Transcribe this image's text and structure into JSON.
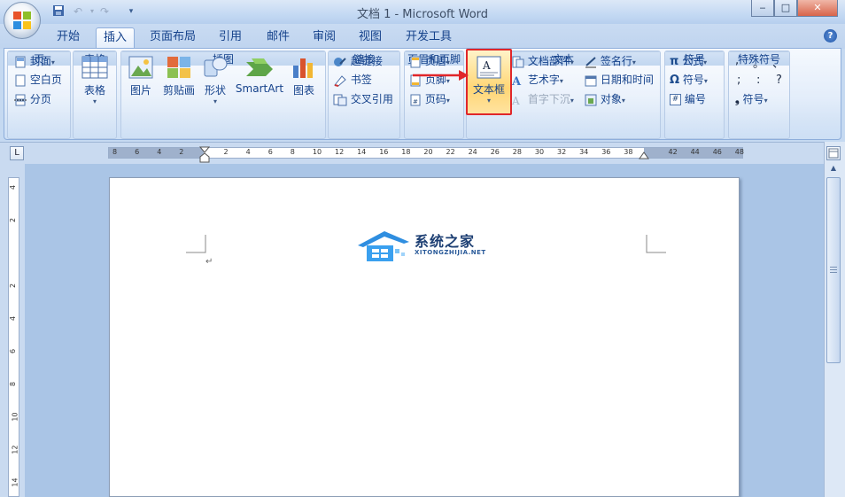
{
  "window": {
    "title": "文档 1 - Microsoft Word"
  },
  "quick_access": {
    "save": "save-icon",
    "undo": "↶",
    "redo": "↷",
    "more": "▾"
  },
  "window_buttons": {
    "minimize": "‒",
    "maximize": "□",
    "close": "✕"
  },
  "tabs": [
    "开始",
    "插入",
    "页面布局",
    "引用",
    "邮件",
    "审阅",
    "视图",
    "开发工具"
  ],
  "active_tab": "插入",
  "help": "?",
  "ribbon": {
    "pages": {
      "label": "页",
      "cover": "封面",
      "blank": "空白页",
      "break": "分页"
    },
    "tables": {
      "label": "表格",
      "table": "表格"
    },
    "illustrations": {
      "label": "插图",
      "picture": "图片",
      "clipart": "剪贴画",
      "shapes": "形状",
      "smartart": "SmartArt",
      "chart": "图表"
    },
    "links": {
      "label": "链接",
      "hyperlink": "超链接",
      "bookmark": "书签",
      "crossref": "交叉引用"
    },
    "header_footer": {
      "label": "页眉和页脚",
      "header": "页眉",
      "footer": "页脚",
      "pagenum": "页码"
    },
    "text": {
      "label": "文本",
      "textbox": "文本框",
      "quickparts": "文档部件",
      "wordart": "艺术字",
      "dropcap": "首字下沉",
      "signature": "签名行",
      "datetime": "日期和时间",
      "object": "对象"
    },
    "symbols": {
      "label": "符号",
      "equation": "公式",
      "symbol": "符号",
      "number": "编号"
    },
    "special": {
      "label": "特殊符号",
      "chars": [
        ",",
        "。",
        "、",
        ";",
        ":",
        "?"
      ],
      "symbol": "符号"
    }
  },
  "ruler_numbers": [
    "8",
    "6",
    "4",
    "2",
    "",
    "2",
    "4",
    "6",
    "8",
    "10",
    "12",
    "14",
    "16",
    "18",
    "20",
    "22",
    "24",
    "26",
    "28",
    "30",
    "32",
    "34",
    "36",
    "38",
    "",
    "42",
    "44",
    "46",
    "48"
  ],
  "left_ruler_numbers": [
    "4",
    "2",
    "",
    "2",
    "4",
    "6",
    "8",
    "10",
    "12",
    "14"
  ],
  "watermark": {
    "cn": "系统之家",
    "en": "XITONGZHIJIA.NET"
  },
  "paragraph_mark": "↵",
  "colors": {
    "highlight": "#e0262a",
    "ribbon_text": "#15428b",
    "page": "#ffffff",
    "doc_bg": "#aac5e6"
  }
}
